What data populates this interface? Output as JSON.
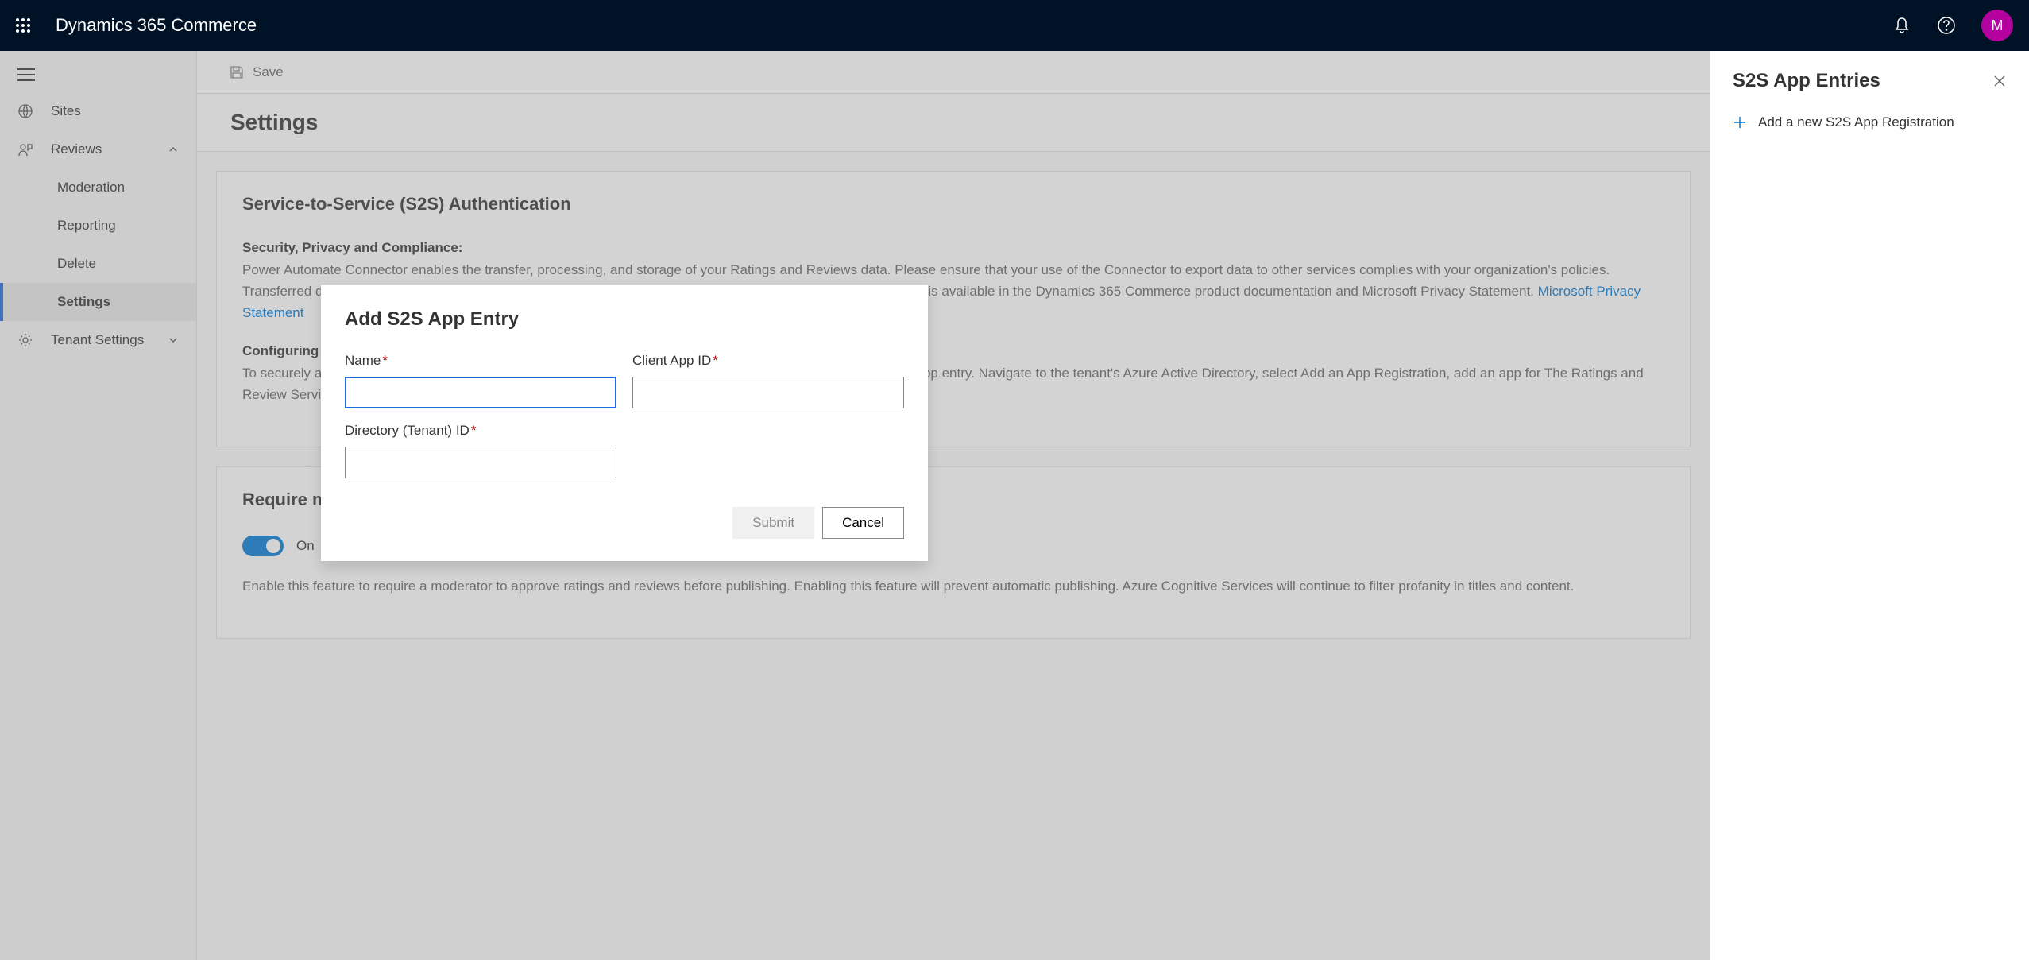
{
  "header": {
    "app_title": "Dynamics 365 Commerce",
    "avatar_initial": "M"
  },
  "sidebar": {
    "items": {
      "sites": "Sites",
      "reviews": "Reviews",
      "moderation": "Moderation",
      "reporting": "Reporting",
      "delete": "Delete",
      "settings": "Settings",
      "tenant_settings": "Tenant Settings"
    }
  },
  "toolbar": {
    "save_label": "Save"
  },
  "page": {
    "title": "Settings"
  },
  "s2s_card": {
    "title": "Service-to-Service (S2S) Authentication",
    "subtitle": "Security, Privacy and Compliance:",
    "body_text": "Power Automate Connector enables the transfer, processing, and storage of your Ratings and Reviews data. Please ensure that your use of the Connector to export data to other services complies with your organization's policies. Transferred data may be processed and stored in a different geography or compliance boundary. More information is available in the Dynamics 365 Commerce product documentation and Microsoft Privacy Statement.",
    "link_text": "Microsoft Privacy Statement",
    "config_title": "Configuring Service-to-Service (S2S) app entry:",
    "config_text": "To securely access Ratings and Reviews data outside of Dynamics 365 Commerce requires a service-to-service app entry. Navigate to the tenant's Azure Active Directory, select Add an App Registration, add an app for The Ratings and Review Service. Enter details from the app (app Name, Client ID assigned, and Directory/Tenant ID of the tenant)."
  },
  "moderator_card": {
    "title": "Require moderator for ratings and reviews",
    "toggle_label": "On",
    "body_text": "Enable this feature to require a moderator to approve ratings and reviews before publishing. Enabling this feature will prevent automatic publishing. Azure Cognitive Services will continue to filter profanity in titles and content."
  },
  "right_panel": {
    "title": "S2S App Entries",
    "add_label": "Add a new S2S App Registration"
  },
  "modal": {
    "title": "Add S2S App Entry",
    "name_label": "Name",
    "client_id_label": "Client App ID",
    "tenant_id_label": "Directory (Tenant) ID",
    "submit_label": "Submit",
    "cancel_label": "Cancel"
  }
}
